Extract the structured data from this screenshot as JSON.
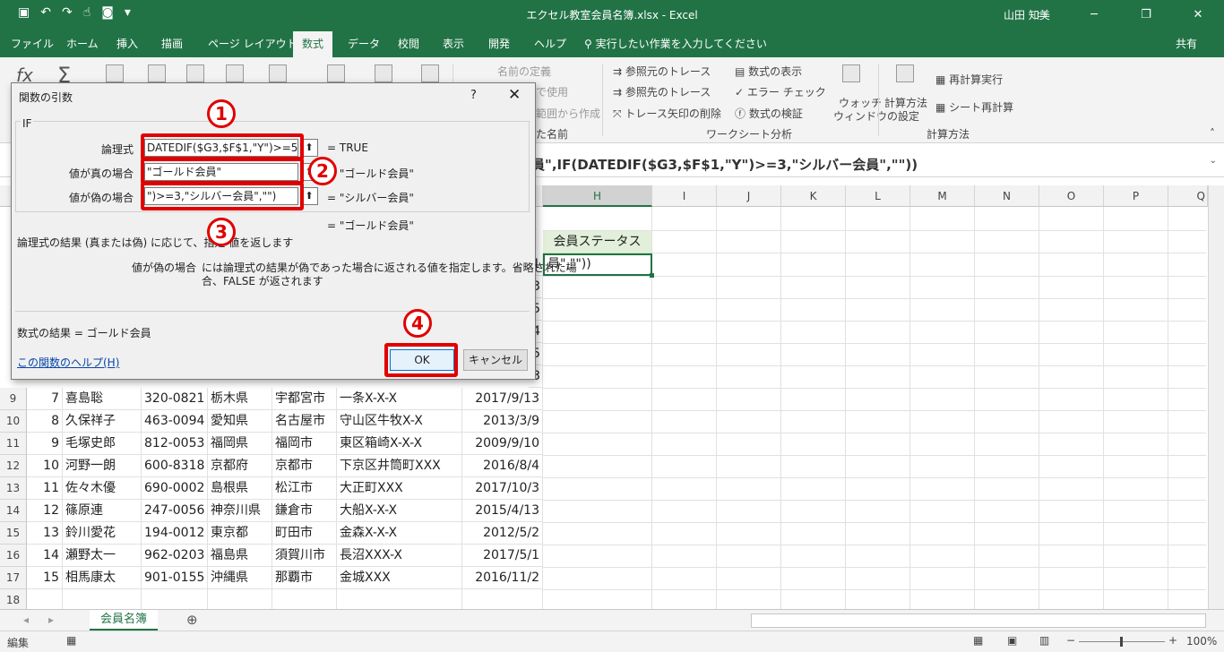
{
  "window": {
    "title": "エクセル教室会員名簿.xlsx  -  Excel",
    "user": "山田 知美"
  },
  "ribbon_tabs": [
    "ファイル",
    "ホーム",
    "挿入",
    "描画",
    "ページ レイアウト",
    "数式",
    "データ",
    "校閲",
    "表示",
    "開発",
    "ヘルプ"
  ],
  "tellme": "実行したい作業を入力してください",
  "share": "共有",
  "ribbon": {
    "names": [
      "名前の定義",
      "で使用",
      "範囲から作成",
      "た名前"
    ],
    "audit": [
      "参照元のトレース",
      "参照先のトレース",
      "トレース矢印の削除",
      "数式の表示",
      "エラー チェック",
      "数式の検証",
      "ウォッチ",
      "ウィンドウ"
    ],
    "audit_group": "ワークシート分析",
    "calc": [
      "計算方法",
      "の設定",
      "再計算実行",
      "シート再計算"
    ],
    "calc_group": "計算方法"
  },
  "formula_bar": {
    "visible_text": "員\",IF(DATEDIF($G3,$F$1,\"Y\")>=3,\"シルバー会員\",\"\"))"
  },
  "columns": [
    "H",
    "I",
    "J",
    "K",
    "L",
    "M",
    "N",
    "O",
    "P",
    "Q"
  ],
  "cells": {
    "H2": "会員ステータス",
    "G3_partial": "1",
    "H3": "員\",\"\"))",
    "G_partials": [
      "3",
      "5",
      "4",
      "5",
      "3"
    ]
  },
  "rows": [
    {
      "row": "9",
      "no": "7",
      "name": "喜島聡",
      "zip": "320-0821",
      "pref": "栃木県",
      "city": "宇都宮市",
      "addr": "一条X-X-X",
      "date": "2017/9/13"
    },
    {
      "row": "10",
      "no": "8",
      "name": "久保祥子",
      "zip": "463-0094",
      "pref": "愛知県",
      "city": "名古屋市",
      "addr": "守山区牛牧X-X",
      "date": "2013/3/9"
    },
    {
      "row": "11",
      "no": "9",
      "name": "毛塚史郎",
      "zip": "812-0053",
      "pref": "福岡県",
      "city": "福岡市",
      "addr": "東区箱崎X-X-X",
      "date": "2009/9/10"
    },
    {
      "row": "12",
      "no": "10",
      "name": "河野一朗",
      "zip": "600-8318",
      "pref": "京都府",
      "city": "京都市",
      "addr": "下京区井筒町XXX",
      "date": "2016/8/4"
    },
    {
      "row": "13",
      "no": "11",
      "name": "佐々木優",
      "zip": "690-0002",
      "pref": "島根県",
      "city": "松江市",
      "addr": "大正町XXX",
      "date": "2017/10/3"
    },
    {
      "row": "14",
      "no": "12",
      "name": "篠原連",
      "zip": "247-0056",
      "pref": "神奈川県",
      "city": "鎌倉市",
      "addr": "大船X-X-X",
      "date": "2015/4/13"
    },
    {
      "row": "15",
      "no": "13",
      "name": "鈴川愛花",
      "zip": "194-0012",
      "pref": "東京都",
      "city": "町田市",
      "addr": "金森X-X-X",
      "date": "2012/5/2"
    },
    {
      "row": "16",
      "no": "14",
      "name": "瀬野太一",
      "zip": "962-0203",
      "pref": "福島県",
      "city": "須賀川市",
      "addr": "長沼XXX-X",
      "date": "2017/5/1"
    },
    {
      "row": "17",
      "no": "15",
      "name": "相馬康太",
      "zip": "901-0155",
      "pref": "沖縄県",
      "city": "那覇市",
      "addr": "金城XXX",
      "date": "2016/11/2"
    },
    {
      "row": "18",
      "no": "",
      "name": "",
      "zip": "",
      "pref": "",
      "city": "",
      "addr": "",
      "date": ""
    }
  ],
  "sheet_tab": "会員名簿",
  "status": {
    "mode": "編集",
    "zoom": "100%"
  },
  "dialog": {
    "title": "関数の引数",
    "help_q": "?",
    "close": "✕",
    "function_name": "IF",
    "fields": [
      {
        "label": "論理式",
        "value": "DATEDIF($G3,$F$1,\"Y\")>=5",
        "result": "=  TRUE"
      },
      {
        "label": "値が真の場合",
        "value": "\"ゴールド会員\"",
        "result": "=  \"ゴールド会員\""
      },
      {
        "label": "値が偽の場合",
        "value": "\")>=3,\"シルバー会員\",\"\")",
        "result": "=  \"シルバー会員\""
      }
    ],
    "overall_result": "=  \"ゴールド会員\"",
    "desc": "論理式の結果 (真または偽) に応じて、指定  値を返します",
    "arg_name": "値が偽の場合",
    "arg_desc_1": "には論理式の結果が偽であった場合に返される値を指定します。省略された場",
    "arg_desc_2": "合、FALSE が返されます",
    "formula_result": "数式の結果 =   ゴールド会員",
    "help_link": "この関数のヘルプ(H)",
    "ok": "OK",
    "cancel": "キャンセル"
  },
  "annotations": {
    "n1": "1",
    "n2": "2",
    "n3": "3",
    "n4": "4",
    "color": "#e00000"
  }
}
